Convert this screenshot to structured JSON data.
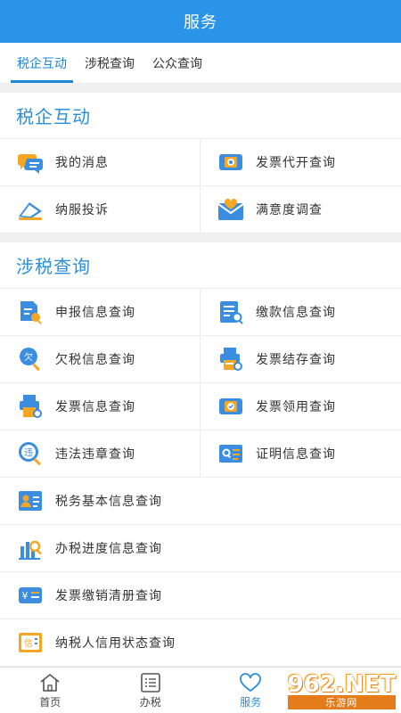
{
  "header": {
    "title": "服务"
  },
  "tabs": [
    {
      "label": "税企互动",
      "active": true
    },
    {
      "label": "涉税查询",
      "active": false
    },
    {
      "label": "公众查询",
      "active": false
    }
  ],
  "sections": {
    "interact": {
      "title": "税企互动",
      "items": [
        {
          "label": "我的消息",
          "icon": "message-icon"
        },
        {
          "label": "发票代开查询",
          "icon": "invoice-issue-icon"
        },
        {
          "label": "纳服投诉",
          "icon": "complaint-icon"
        },
        {
          "label": "满意度调查",
          "icon": "satisfaction-icon"
        }
      ]
    },
    "query": {
      "title": "涉税查询",
      "items": [
        {
          "label": "申报信息查询",
          "icon": "declare-query-icon"
        },
        {
          "label": "缴款信息查询",
          "icon": "payment-query-icon"
        },
        {
          "label": "欠税信息查询",
          "icon": "arrears-query-icon"
        },
        {
          "label": "发票结存查询",
          "icon": "invoice-stock-icon"
        },
        {
          "label": "发票信息查询",
          "icon": "invoice-info-icon"
        },
        {
          "label": "发票领用查询",
          "icon": "invoice-receive-icon"
        },
        {
          "label": "违法违章查询",
          "icon": "violation-query-icon"
        },
        {
          "label": "证明信息查询",
          "icon": "certificate-query-icon"
        },
        {
          "label": "税务基本信息查询",
          "icon": "tax-basic-info-icon"
        },
        {
          "label": "办税进度信息查询",
          "icon": "progress-query-icon"
        },
        {
          "label": "发票缴销清册查询",
          "icon": "invoice-cancel-icon"
        },
        {
          "label": "纳税人信用状态查询",
          "icon": "credit-status-icon"
        }
      ]
    }
  },
  "bottom_nav": [
    {
      "label": "首页",
      "icon": "home-icon",
      "active": false
    },
    {
      "label": "办税",
      "icon": "list-icon",
      "active": false
    },
    {
      "label": "服务",
      "icon": "heart-icon",
      "active": true
    }
  ],
  "watermark": {
    "logo": "962.NET",
    "sub": "乐游网"
  },
  "colors": {
    "accent": "#2a95e8",
    "accent_text": "#2b8fd9",
    "icon_orange": "#f5a623"
  }
}
